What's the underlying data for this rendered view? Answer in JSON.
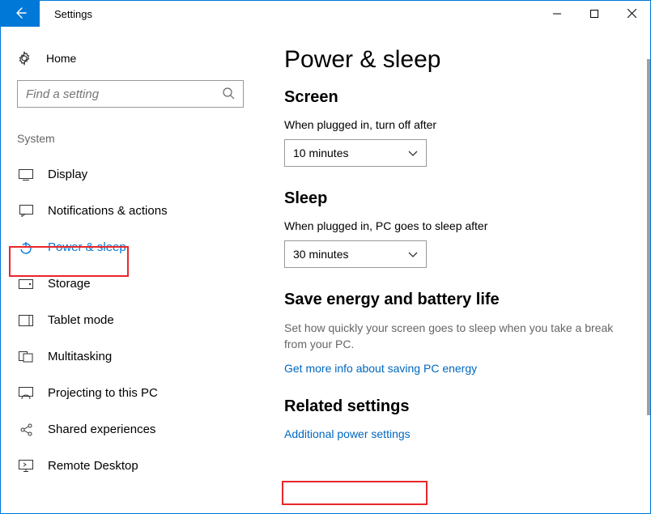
{
  "window": {
    "title": "Settings"
  },
  "sidebar": {
    "home_label": "Home",
    "search_placeholder": "Find a setting",
    "section_label": "System",
    "items": [
      {
        "label": "Display"
      },
      {
        "label": "Notifications & actions"
      },
      {
        "label": "Power & sleep"
      },
      {
        "label": "Storage"
      },
      {
        "label": "Tablet mode"
      },
      {
        "label": "Multitasking"
      },
      {
        "label": "Projecting to this PC"
      },
      {
        "label": "Shared experiences"
      },
      {
        "label": "Remote Desktop"
      }
    ]
  },
  "main": {
    "title": "Power & sleep",
    "screen": {
      "heading": "Screen",
      "label": "When plugged in, turn off after",
      "value": "10 minutes"
    },
    "sleep": {
      "heading": "Sleep",
      "label": "When plugged in, PC goes to sleep after",
      "value": "30 minutes"
    },
    "save_energy": {
      "heading": "Save energy and battery life",
      "desc": "Set how quickly your screen goes to sleep when you take a break from your PC.",
      "link": "Get more info about saving PC energy"
    },
    "related": {
      "heading": "Related settings",
      "link": "Additional power settings"
    }
  }
}
